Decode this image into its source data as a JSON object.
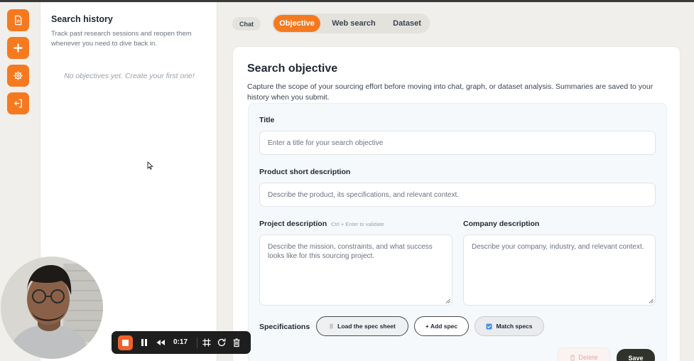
{
  "rail": {
    "items": [
      {
        "icon": "document-icon"
      },
      {
        "icon": "plus-icon"
      },
      {
        "icon": "gear-icon"
      },
      {
        "icon": "logout-icon"
      }
    ],
    "accent": "#f57a1f"
  },
  "history": {
    "title": "Search history",
    "subtitle": "Track past research sessions and reopen them whenever you need to dive back in.",
    "empty_text": "No objectives yet. Create your first one!"
  },
  "tabs": {
    "chat": "Chat",
    "items": [
      {
        "label": "Objective",
        "active": true
      },
      {
        "label": "Web search",
        "active": false
      },
      {
        "label": "Dataset",
        "active": false
      }
    ]
  },
  "objective": {
    "title": "Search objective",
    "description": "Capture the scope of your sourcing effort before moving into chat, graph, or dataset analysis. Summaries are saved to your history when you submit.",
    "fields": {
      "title_label": "Title",
      "title_placeholder": "Enter a title for your search objective",
      "product_label": "Product short description",
      "product_placeholder": "Describe the product, its specifications, and relevant context.",
      "project_label": "Project description",
      "project_hint": "Ctrl + Enter to validate",
      "project_placeholder": "Describe the mission, constraints, and what success looks like for this sourcing project.",
      "company_label": "Company description",
      "company_placeholder": "Describe your company, industry, and relevant context."
    },
    "specs": {
      "label": "Specifications",
      "load_button": "Load the spec sheet",
      "add_button": "+ Add spec",
      "match_button": "Match specs"
    },
    "actions": {
      "delete": "Delete",
      "save": "Save"
    }
  },
  "recorder": {
    "time": "0:17",
    "stop_color": "#f0622c"
  }
}
